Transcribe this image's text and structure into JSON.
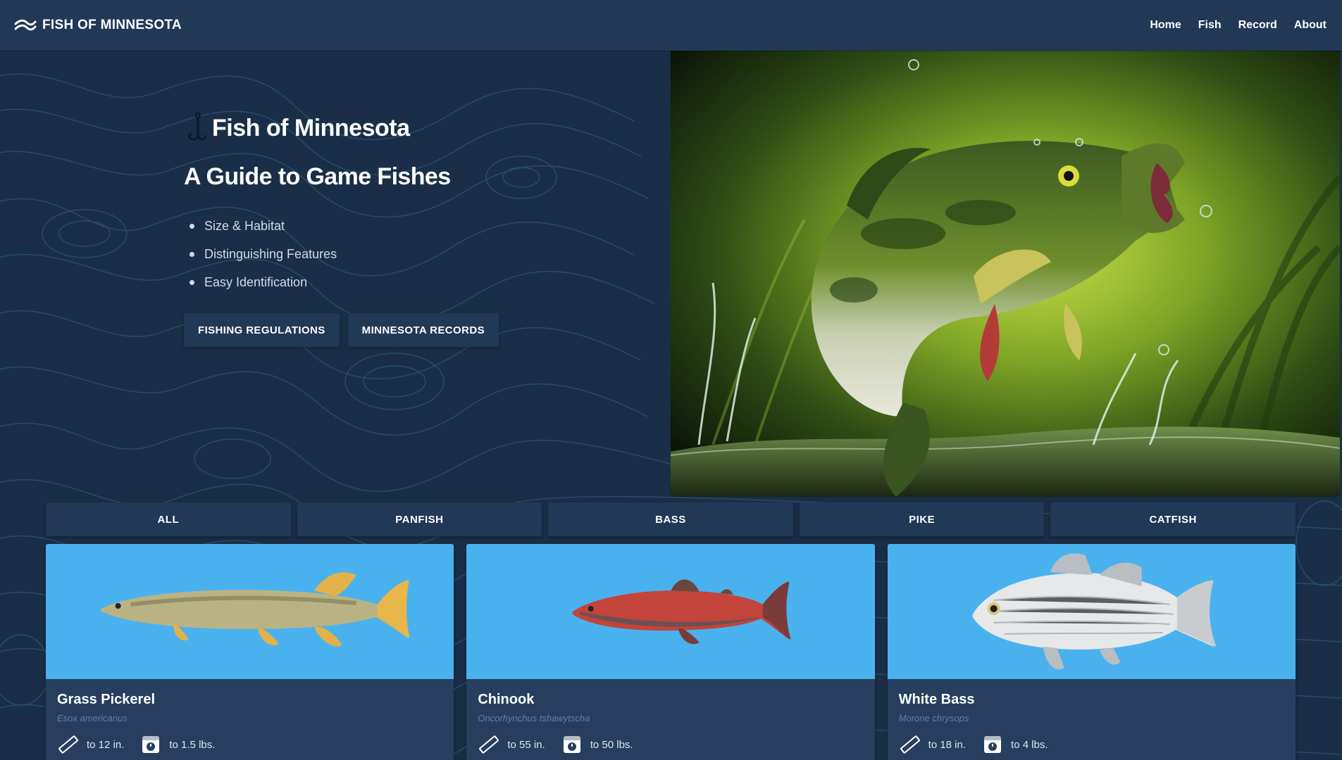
{
  "nav": {
    "brand": "FISH OF MINNESOTA",
    "brand_icon": "wave-icon",
    "links": [
      "Home",
      "Fish",
      "Record",
      "About"
    ]
  },
  "hero": {
    "title": "Fish of Minnesota",
    "title_icon": "fish-hook-icon",
    "subtitle": "A Guide to Game Fishes",
    "features": [
      "Size & Habitat",
      "Distinguishing Features",
      "Easy Identification"
    ],
    "buttons": [
      "FISHING REGULATIONS",
      "MINNESOTA RECORDS"
    ],
    "image": "largemouth-bass-jumping-illustration"
  },
  "filters": [
    "ALL",
    "PANFISH",
    "BASS",
    "PIKE",
    "CATFISH"
  ],
  "cards": [
    {
      "name": "Grass Pickerel",
      "scientific": "Esox americanus",
      "length": "to 12 in.",
      "weight": "to 1.5 lbs."
    },
    {
      "name": "Chinook",
      "scientific": "Oncorhynchus tshawytscha",
      "length": "to 55 in.",
      "weight": "to 50 lbs."
    },
    {
      "name": "White Bass",
      "scientific": "Morone chrysops",
      "length": "to 18 in.",
      "weight": "to 4 lbs."
    }
  ],
  "colors": {
    "background": "#1b2e47",
    "navbar": "#223857",
    "card": "#273e5e",
    "card_image_bg": "#4ab1ef",
    "topo_lines": "#2c6b91"
  }
}
